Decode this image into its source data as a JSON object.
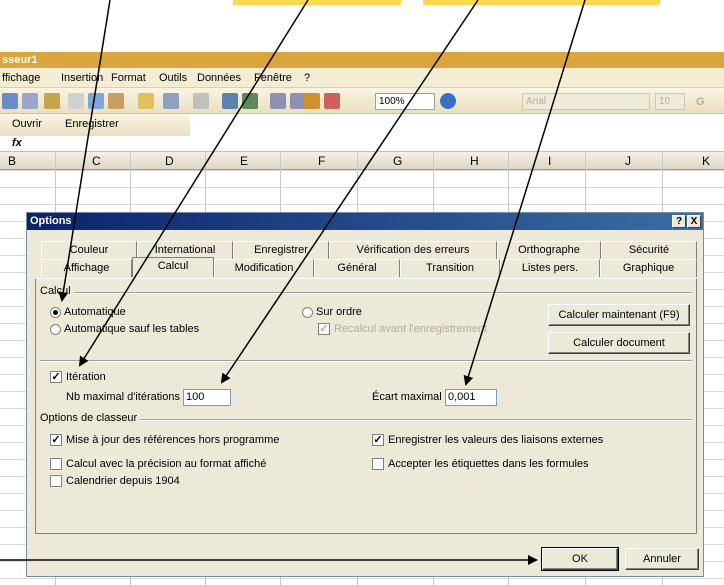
{
  "window": {
    "title": "sseur1"
  },
  "menu": [
    "ffichage",
    "Insertion",
    "Format",
    "Outils",
    "Données",
    "Fenêtre",
    "?"
  ],
  "toolbar": {
    "zoom": "100%",
    "font": "Arial",
    "size": "10",
    "bold": "G"
  },
  "toolbar2": {
    "open": "Ouvrir",
    "save": "Enregistrer"
  },
  "formula_bar": {
    "fx": "fx"
  },
  "columns": [
    "B",
    "C",
    "D",
    "E",
    "F",
    "G",
    "H",
    "I",
    "J",
    "K"
  ],
  "dialog": {
    "title": "Options",
    "title_buttons": [
      "?",
      "X"
    ],
    "tabs_row1": [
      "Couleur",
      "International",
      "Enregistrer",
      "Vérification des erreurs",
      "Orthographe",
      "Sécurité"
    ],
    "tabs_row2": [
      "Affichage",
      "Calcul",
      "Modification",
      "Général",
      "Transition",
      "Listes pers.",
      "Graphique"
    ],
    "calcul": {
      "section": "Calcul",
      "radio_auto": "Automatique",
      "radio_auto_sauf": "Automatique sauf les tables",
      "radio_sur_ordre": "Sur ordre",
      "check_recalc": "Recalcul avant l'enregistrement",
      "btn_calc_now": "Calculer maintenant (F9)",
      "btn_calc_doc": "Calculer document"
    },
    "iteration": {
      "check_label": "Itération",
      "max_iter_label": "Nb maximal d'itérations :",
      "max_iter_value": "100",
      "max_delta_label": "Écart maximal :",
      "max_delta_value": "0,001"
    },
    "workbook": {
      "section": "Options de classeur",
      "check_update_refs": "Mise à jour des références hors programme",
      "check_precision": "Calcul avec la précision au format affiché",
      "check_1904": "Calendrier depuis 1904",
      "check_save_links": "Enregistrer les valeurs des liaisons externes",
      "check_accept_labels": "Accepter les étiquettes dans les formules"
    },
    "buttons": {
      "ok": "OK",
      "cancel": "Annuler"
    }
  }
}
